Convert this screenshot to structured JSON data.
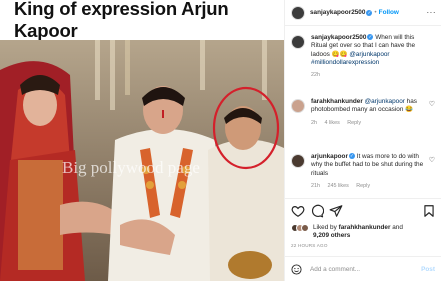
{
  "photo": {
    "banner_title": "King of expression Arjun Kapoor",
    "watermark": "Big pollywood page"
  },
  "post": {
    "username": "sanjaykapoor2500",
    "separator": "•",
    "follow_label": "Follow",
    "more_label": "···",
    "caption": {
      "username": "sanjaykapoor2500",
      "text": "When will this Ritual get over so that I can have the ladoos 😋😋",
      "mention": "@arjunkapoor",
      "hashtag": "#milliondollarexpression",
      "time": "22h"
    },
    "comments": [
      {
        "username": "farahkhankunder",
        "mention": "@arjunkapoor",
        "text": "has photobombed many an occasion 😂",
        "time": "2h",
        "likes": "4 likes",
        "reply": "Reply"
      },
      {
        "username": "arjunkapoor",
        "text": "It was more to do with why the buffet had to be shut during the rituals",
        "time": "21h",
        "likes": "245 likes",
        "reply": "Reply"
      }
    ],
    "liked_by_prefix": "Liked by",
    "liked_by_user": "farahkhankunder",
    "liked_by_and": "and",
    "liked_by_others": "9,209 others",
    "time_ago": "22 HOURS AGO",
    "add_comment_placeholder": "Add a comment...",
    "post_label": "Post"
  },
  "colors": {
    "accent": "#0095f6",
    "verified": "#3897f0",
    "circle_highlight": "#d4202b"
  }
}
